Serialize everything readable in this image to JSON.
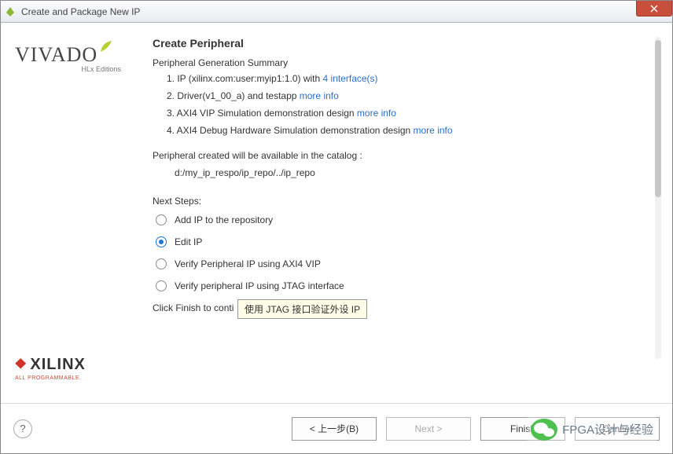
{
  "window": {
    "title": "Create and Package New IP"
  },
  "header": {
    "title": "Create Peripheral"
  },
  "summary": {
    "label": "Peripheral Generation Summary",
    "items": [
      {
        "prefix": "1. IP (xilinx.com:user:myip1:1.0) with ",
        "link": "4 interface(s)"
      },
      {
        "prefix": "2. Driver(v1_00_a) and testapp ",
        "link": "more info"
      },
      {
        "prefix": "3. AXI4 VIP Simulation demonstration design ",
        "link": "more info"
      },
      {
        "prefix": "4. AXI4 Debug Hardware Simulation demonstration design ",
        "link": "more info"
      }
    ]
  },
  "catalog": {
    "label": "Peripheral created will be available in the catalog :",
    "path": "d:/my_ip_respo/ip_repo/../ip_repo"
  },
  "next": {
    "label": "Next Steps:",
    "options": [
      {
        "label": "Add IP to the repository",
        "selected": false
      },
      {
        "label": "Edit IP",
        "selected": true
      },
      {
        "label": "Verify Peripheral IP using AXI4 VIP",
        "selected": false
      },
      {
        "label": "Verify peripheral IP using JTAG interface",
        "selected": false
      }
    ]
  },
  "finish_prefix": "Click Finish to conti",
  "tooltip": "使用 JTAG 接口验证外设 IP",
  "logos": {
    "vivado": "VIVADO",
    "vivado_sub": "HLx Editions",
    "xilinx": "XILINX",
    "xilinx_tag": "ALL PROGRAMMABLE."
  },
  "buttons": {
    "back": "< 上一步(B)",
    "next": "Next >",
    "finish": "Finish",
    "cancel": "Cancel"
  },
  "watermark": "FPGA设计与经验"
}
